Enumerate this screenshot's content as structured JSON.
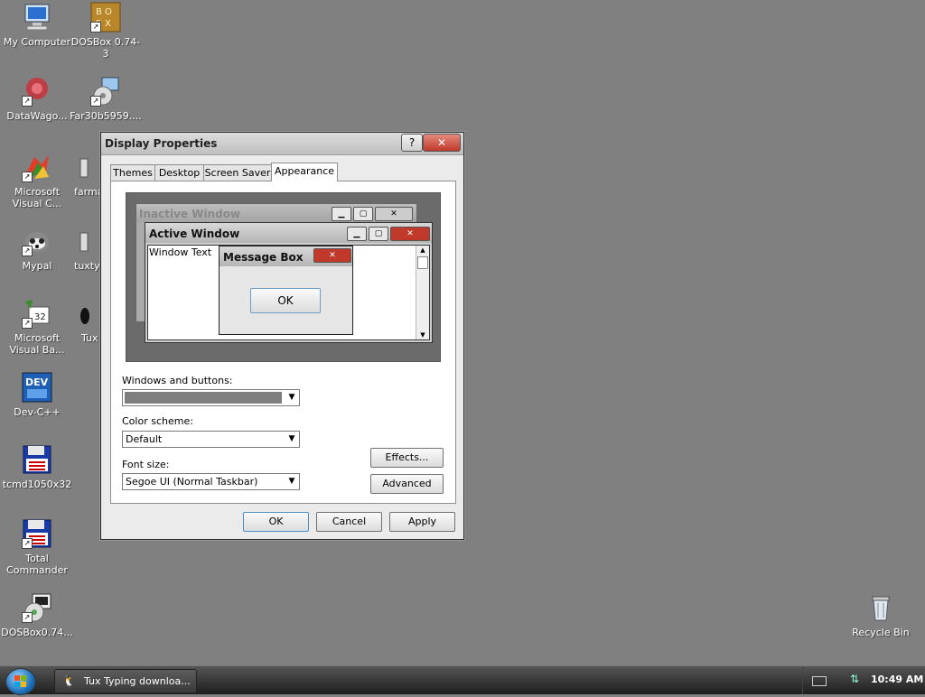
{
  "desktop": {
    "icons": [
      {
        "label": "My Computer"
      },
      {
        "label": "DOSBox 0.74-3"
      },
      {
        "label": "DataWago..."
      },
      {
        "label": "Far30b5959...."
      },
      {
        "label": "Microsoft Visual C..."
      },
      {
        "label": "farma"
      },
      {
        "label": "Mypal"
      },
      {
        "label": "tuxtyp"
      },
      {
        "label": "Microsoft Visual Ba..."
      },
      {
        "label": "Tux"
      },
      {
        "label": "Dev-C++"
      },
      {
        "label": "tcmd1050x32"
      },
      {
        "label": "Total Commander"
      },
      {
        "label": "DOSBox0.74..."
      },
      {
        "label": "Recycle Bin"
      }
    ]
  },
  "dialog": {
    "title": "Display Properties",
    "help_label": "?",
    "close_label": "✕",
    "tabs": [
      {
        "label": "Themes"
      },
      {
        "label": "Desktop"
      },
      {
        "label": "Screen Saver"
      },
      {
        "label": "Appearance"
      }
    ],
    "preview": {
      "inactive_title": "Inactive Window",
      "active_title": "Active Window",
      "window_text": "Window Text",
      "message_title": "Message Box",
      "message_ok": "OK"
    },
    "windows_buttons_label": "Windows and buttons:",
    "color_scheme_label": "Color scheme:",
    "color_scheme_value": "Default",
    "font_size_label": "Font size:",
    "font_size_value": "Segoe UI (Normal Taskbar)",
    "effects_label": "Effects...",
    "advanced_label": "Advanced",
    "ok_label": "OK",
    "cancel_label": "Cancel",
    "apply_label": "Apply"
  },
  "taskbar": {
    "task_label": "Tux Typing downloa...",
    "clock": "10:49 AM"
  }
}
